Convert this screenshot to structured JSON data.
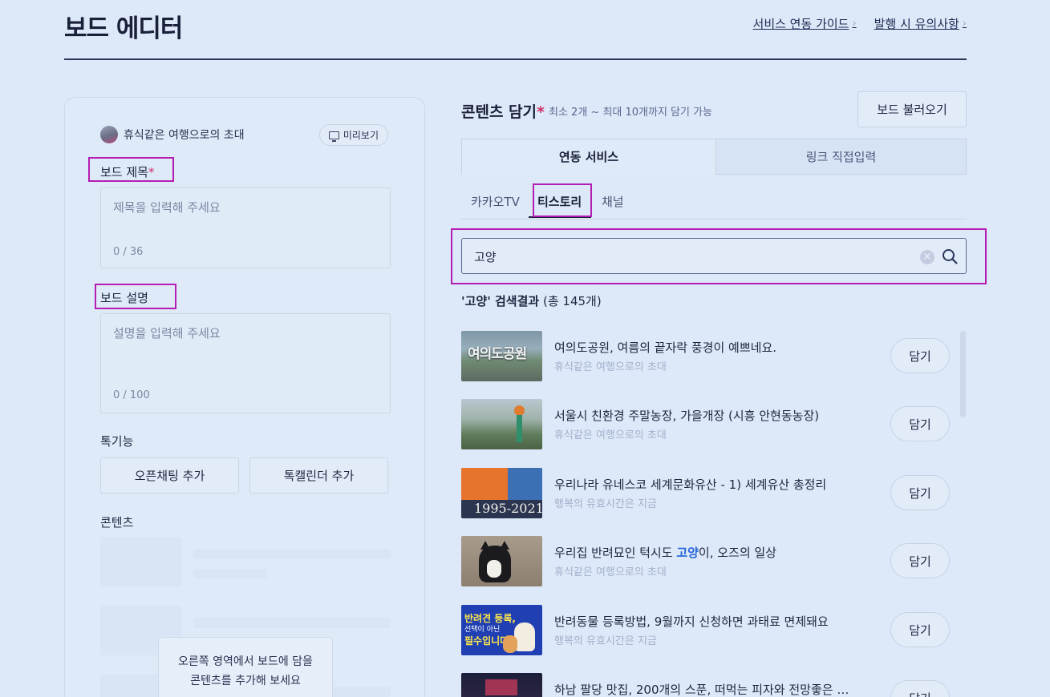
{
  "header": {
    "title": "보드 에디터",
    "links": [
      "서비스 연동 가이드",
      "발행 시 유의사항"
    ],
    "chevron": "›"
  },
  "left": {
    "profile_name": "휴식같은 여행으로의 초대",
    "preview_label": "미리보기",
    "title_label": "보드 제목",
    "required_mark": "*",
    "title_placeholder": "제목을 입력해 주세요",
    "title_counter": "0 / 36",
    "desc_label": "보드 설명",
    "desc_placeholder": "설명을 입력해 주세요",
    "desc_counter": "0 / 100",
    "features_label": "톡기능",
    "openchat_button": "오픈채팅 추가",
    "talkcalendar_button": "톡캘린더 추가",
    "contents_label": "콘텐츠",
    "tooltip_line1": "오른쪽 영역에서 보드에 담을",
    "tooltip_line2": "콘텐츠를 추가해 보세요"
  },
  "right": {
    "title": "콘텐츠 담기",
    "required_mark": "*",
    "subtitle": "최소 2개 ~ 최대 10개까지 담기 가능",
    "load_button": "보드 불러오기",
    "segments": [
      "연동 서비스",
      "링크 직접입력"
    ],
    "subtabs": [
      "카카오TV",
      "티스토리",
      "채널"
    ],
    "search_value": "고양",
    "clear_symbol": "×",
    "result_query": "'고양' 검색결과",
    "result_count": "(총 145개)",
    "add_label": "담기",
    "items": [
      {
        "title": "여의도공원, 여름의 끝자락 풍경이 예쁘네요.",
        "sub": "휴식같은 여행으로의 초대"
      },
      {
        "title": "서울시 친환경 주말농장, 가을개장 (시흥 안현동농장)",
        "sub": "휴식같은 여행으로의 초대"
      },
      {
        "title": "우리나라 유네스코 세계문화유산 - 1) 세계유산 총정리",
        "sub": "행복의 유효시간은 지금"
      },
      {
        "title_pre": "우리집 반려묘인 턱시도 ",
        "title_kw": "고양",
        "title_post": "이, 오즈의 일상",
        "sub": "휴식같은 여행으로의 초대"
      },
      {
        "title": "반려동물 등록방법, 9월까지 신청하면 과태료 면제돼요",
        "sub": "행복의 유효시간은 지금"
      },
      {
        "title": "하남 팔당 맛집, 200개의 스푼, 떠먹는 피자와 전망좋은 …",
        "sub": ""
      }
    ],
    "thumb_texts": {
      "park_sign": "여의도공원",
      "years": "1995-2021",
      "pet_reg_line1": "반려견 등록,",
      "pet_reg_line2": "선택이 아닌",
      "pet_reg_line3": "필수입니다."
    }
  }
}
